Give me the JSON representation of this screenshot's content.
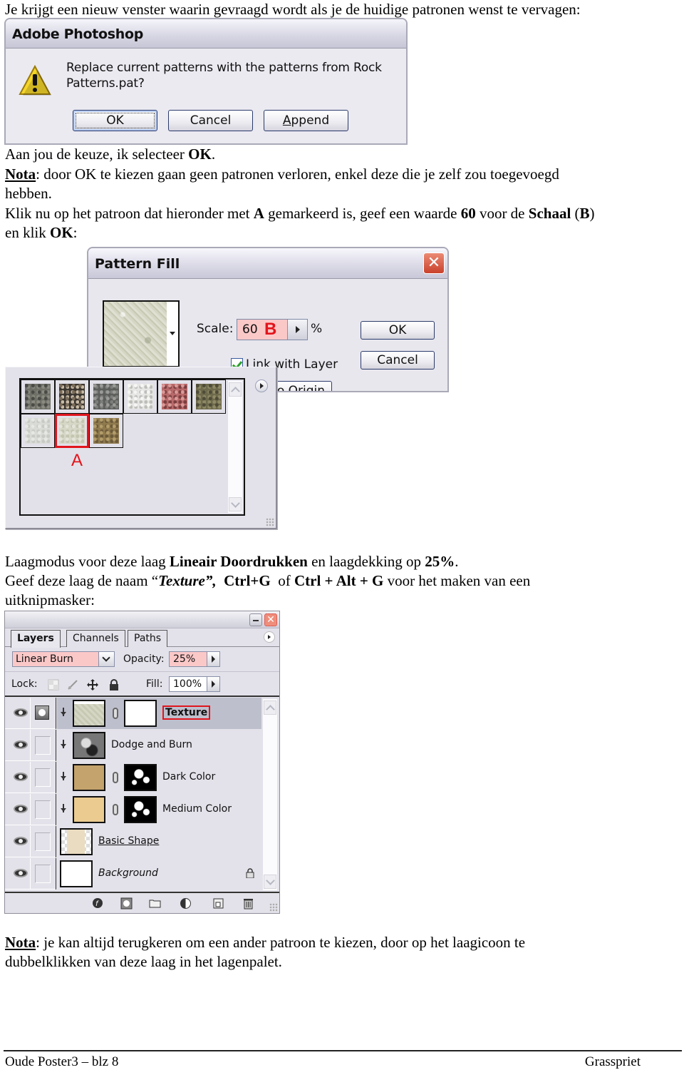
{
  "intro_text": "Je krijgt een nieuw venster waarin gevraagd wordt als je de huidige patronen wenst te vervagen:",
  "replace_dialog": {
    "title": "Adobe Photoshop",
    "message_line1": "Replace current patterns with the patterns from Rock",
    "message_line2": "Patterns.pat?",
    "buttons": {
      "ok": "OK",
      "cancel": "Cancel",
      "append": "Append"
    },
    "icon": "warning-icon"
  },
  "paragraph_choice": {
    "text": "Aan jou de keuze, ik selecteer ",
    "bold": "OK",
    "end": "."
  },
  "paragraph_note1": {
    "label": "Nota",
    "line1": ": door OK te kiezen gaan geen patronen verloren, enkel deze die je zelf zou toegevoegd",
    "line2": "hebben."
  },
  "paragraph_click": {
    "p1": "Klik nu op het patroon dat hieronder met ",
    "b1": "A",
    "p2": " gemarkeerd is, geef een waarde ",
    "b2": "60",
    "p3": " voor de ",
    "b3": "Schaal",
    "p4": " (",
    "b4": "B",
    "p5": ")",
    "l2a": "en klik ",
    "l2b": "OK",
    "l2c": ":"
  },
  "pattern_fill_dialog": {
    "title": "Pattern Fill",
    "scale_label": "Scale:",
    "scale_value": "60",
    "scale_marker": "B",
    "percent": "%",
    "link_with_layer": "Link with Layer",
    "link_with_layer_checked": true,
    "snap_to_origin": "Snap to Origin",
    "ok": "OK",
    "cancel": "Cancel"
  },
  "pattern_picker": {
    "marker_label": "A",
    "selected_index": 7,
    "patterns": [
      {
        "name": "dark-rock",
        "colors": [
          "#6f7068",
          "#8a8a80",
          "#4a4b45"
        ]
      },
      {
        "name": "pebbles",
        "colors": [
          "#3a3530",
          "#c9bca6",
          "#7a6c5a"
        ]
      },
      {
        "name": "grey-granite",
        "colors": [
          "#5c5e5c",
          "#7b7d7a",
          "#9a9b98"
        ]
      },
      {
        "name": "white-speckle",
        "colors": [
          "#e6e6e4",
          "#bdbdba",
          "#f6f6f4"
        ]
      },
      {
        "name": "red-granite",
        "colors": [
          "#b9696a",
          "#7a3e3f",
          "#d99a98"
        ]
      },
      {
        "name": "mossy-stone",
        "colors": [
          "#6e6a4c",
          "#8f8a66",
          "#4e4c38"
        ]
      },
      {
        "name": "pale-stone",
        "colors": [
          "#d9dbd6",
          "#c8cac4",
          "#e6e8e4"
        ]
      },
      {
        "name": "pale-green-stone",
        "colors": [
          "#d6d7c6",
          "#c3c5b0",
          "#e4e4d8"
        ]
      },
      {
        "name": "sand-gravel",
        "colors": [
          "#8f7a4e",
          "#6b5a3a",
          "#b39d6a"
        ]
      }
    ]
  },
  "paragraph_blend": {
    "p1": "Laagmodus voor deze laag ",
    "b1": "Lineair Doordrukken",
    "p2": " en laagdekking op ",
    "b2": "25%",
    "p3": "."
  },
  "paragraph_name": {
    "p1": "Geef deze laag de naam “",
    "bi1": "Texture”,",
    "p2": "  ",
    "b2": "Ctrl+G",
    "p3": "  of ",
    "b3": "Ctrl + Alt + G",
    "p4": " voor het maken van een",
    "line2": "uitknipmasker:"
  },
  "layers_panel": {
    "tabs": [
      "Layers",
      "Channels",
      "Paths"
    ],
    "active_tab": "Layers",
    "blend_mode": "Linear Burn",
    "opacity_label": "Opacity:",
    "opacity_value": "25%",
    "lock_label": "Lock:",
    "fill_label": "Fill:",
    "fill_value": "100%",
    "layers": [
      {
        "name": "Texture",
        "visible": true,
        "clipped": true,
        "selected": true,
        "thumb": "#d4d5c3",
        "has_mask": true,
        "mask": "white"
      },
      {
        "name": "Dodge and Burn",
        "visible": true,
        "clipped": true,
        "selected": false,
        "thumb": "#7a7a7a",
        "has_mask": false
      },
      {
        "name": "Dark Color",
        "visible": true,
        "clipped": true,
        "selected": false,
        "thumb": "#c4a36c",
        "has_mask": true,
        "mask": "black-white"
      },
      {
        "name": "Medium Color",
        "visible": true,
        "clipped": true,
        "selected": false,
        "thumb": "#ebcb90",
        "has_mask": true,
        "mask": "black-white"
      },
      {
        "name": "Basic Shape",
        "visible": true,
        "clipped": false,
        "selected": false,
        "thumb": "#eadcc0",
        "has_mask": false
      },
      {
        "name": "Background",
        "visible": true,
        "clipped": false,
        "selected": false,
        "thumb": "#ffffff",
        "has_mask": false,
        "locked": true
      }
    ],
    "footer_icons": [
      "layer-style-icon",
      "add-mask-icon",
      "new-group-icon",
      "adjustment-layer-icon",
      "new-layer-icon",
      "trash-icon"
    ]
  },
  "paragraph_note2": {
    "label": "Nota",
    "line1": ": je kan altijd terugkeren om een ander patroon te kiezen, door op het laagicoon te",
    "line2": "dubbelklikken van deze laag in het lagenpalet."
  },
  "footer": {
    "left": "Oude Poster3 – blz 8",
    "right": "Grasspriet"
  },
  "colors": {
    "accent_red": "#e3141b",
    "highlight_pink": "#fbc8c8"
  }
}
